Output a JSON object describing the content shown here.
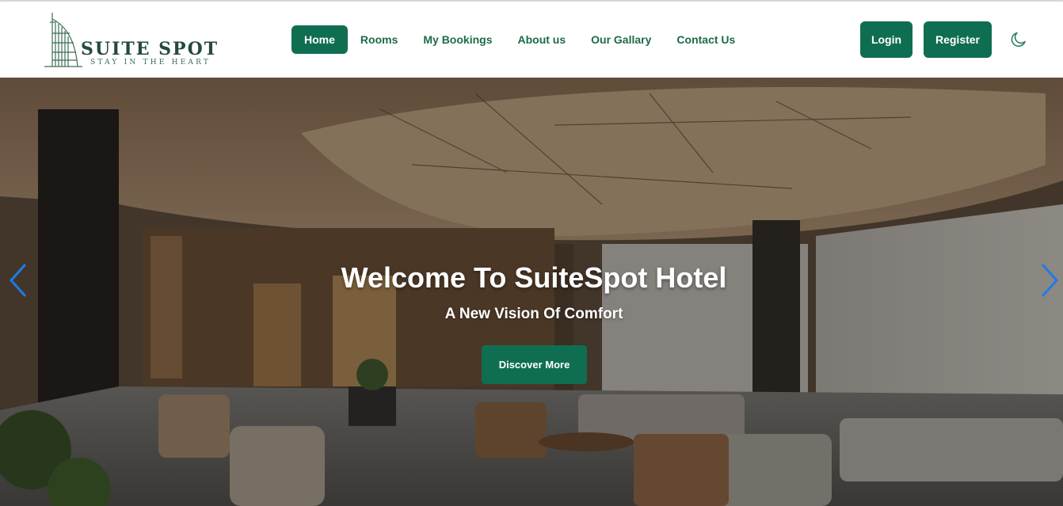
{
  "brand": {
    "name": "SUITE SPOT",
    "tagline": "STAY IN THE HEART"
  },
  "nav": {
    "items": [
      {
        "label": "Home",
        "active": true
      },
      {
        "label": "Rooms",
        "active": false
      },
      {
        "label": "My Bookings",
        "active": false
      },
      {
        "label": "About us",
        "active": false
      },
      {
        "label": "Our Gallary",
        "active": false
      },
      {
        "label": "Contact Us",
        "active": false
      }
    ],
    "login_label": "Login",
    "register_label": "Register",
    "theme_toggle_icon": "moon-icon"
  },
  "hero": {
    "title": "Welcome To SuiteSpot Hotel",
    "subtitle": "A New Vision Of Comfort",
    "cta_label": "Discover More",
    "prev_icon": "chevron-left-icon",
    "next_icon": "chevron-right-icon"
  },
  "colors": {
    "primary": "#0f6e51",
    "nav_text": "#1d6b47",
    "arrow": "#1e7be6"
  }
}
